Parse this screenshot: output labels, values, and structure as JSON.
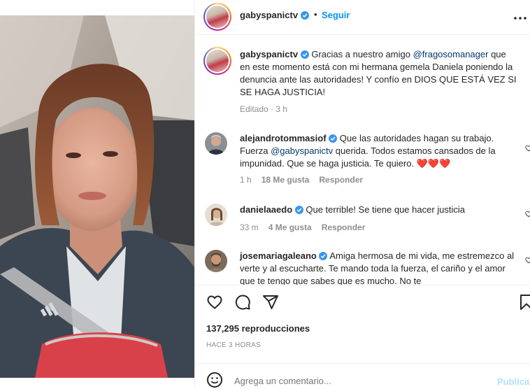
{
  "post": {
    "username": "gabyspanictv",
    "follow_label": "Seguir",
    "dot": "•",
    "more_icon": "more-horizontal-icon",
    "caption_parts": {
      "before": "Gracias a nuestro amigo ",
      "mention": "@fragosomanager",
      "after": " que en este momento está con mi hermana gemela Daniela poniendo la denuncia ante las autoridades! Y confío en DIOS QUE ESTÁ VEZ SI SE HAGA JUSTICIA!"
    },
    "caption_meta": "Editado · 3 h"
  },
  "comments": [
    {
      "username": "alejandrotommasiof",
      "before": " Que las autoridades hagan su trabajo. Fuerza ",
      "mention": "@gabyspanictv",
      "after": " querida. Todos estamos cansados de la impunidad. Que se haga justicia. Te quiero. ❤️❤️❤️",
      "time": "1 h",
      "likes": "18 Me gusta",
      "reply": "Responder"
    },
    {
      "username": "danielaaedo",
      "text": " Que terrible! Se tiene que hacer justicia",
      "time": "33 m",
      "likes": "4 Me gusta",
      "reply": "Responder"
    },
    {
      "username": "josemariagaleano",
      "text": " Amiga hermosa de mi vida, me estremezco al verte y al escucharte. Te mando toda la fuerza, el cariño y el amor que te tengo que sabes que es mucho. No te"
    }
  ],
  "actions": {
    "icons": [
      "heart-icon",
      "comment-icon",
      "share-icon",
      "bookmark-icon"
    ]
  },
  "views": "137,295 reproducciones",
  "posted_ago": "HACE 3 HORAS",
  "add_comment": {
    "placeholder": "Agrega un comentario...",
    "post_label": "Publicar"
  },
  "colors": {
    "accent": "#0095f6",
    "verified": "#3897f0",
    "mention": "#00376b",
    "muted": "#8e8e8e"
  }
}
